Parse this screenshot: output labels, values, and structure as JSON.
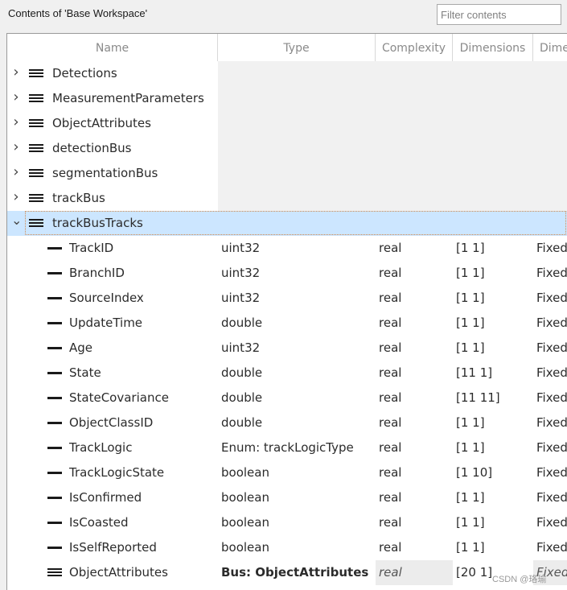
{
  "window": {
    "title": "Contents of 'Base Workspace'"
  },
  "filter": {
    "placeholder": "Filter contents"
  },
  "columns": [
    "Name",
    "Type",
    "Complexity",
    "Dimensions",
    "Dime"
  ],
  "rows": [
    {
      "name": "Detections",
      "type": "",
      "complexity": "",
      "dims": "",
      "dimMode": "",
      "kind": "bus",
      "level": 0,
      "expanded": false
    },
    {
      "name": "MeasurementParameters",
      "type": "",
      "complexity": "",
      "dims": "",
      "dimMode": "",
      "kind": "bus",
      "level": 0,
      "expanded": false
    },
    {
      "name": "ObjectAttributes",
      "type": "",
      "complexity": "",
      "dims": "",
      "dimMode": "",
      "kind": "bus",
      "level": 0,
      "expanded": false
    },
    {
      "name": "detectionBus",
      "type": "",
      "complexity": "",
      "dims": "",
      "dimMode": "",
      "kind": "bus",
      "level": 0,
      "expanded": false
    },
    {
      "name": "segmentationBus",
      "type": "",
      "complexity": "",
      "dims": "",
      "dimMode": "",
      "kind": "bus",
      "level": 0,
      "expanded": false
    },
    {
      "name": "trackBus",
      "type": "",
      "complexity": "",
      "dims": "",
      "dimMode": "",
      "kind": "bus",
      "level": 0,
      "expanded": false
    },
    {
      "name": "trackBusTracks",
      "type": "",
      "complexity": "",
      "dims": "",
      "dimMode": "",
      "kind": "bus",
      "level": 0,
      "expanded": true,
      "selected": true
    },
    {
      "name": "TrackID",
      "type": "uint32",
      "complexity": "real",
      "dims": "[1 1]",
      "dimMode": "Fixed",
      "kind": "element",
      "level": 1
    },
    {
      "name": "BranchID",
      "type": "uint32",
      "complexity": "real",
      "dims": "[1 1]",
      "dimMode": "Fixed",
      "kind": "element",
      "level": 1
    },
    {
      "name": "SourceIndex",
      "type": "uint32",
      "complexity": "real",
      "dims": "[1 1]",
      "dimMode": "Fixed",
      "kind": "element",
      "level": 1
    },
    {
      "name": "UpdateTime",
      "type": "double",
      "complexity": "real",
      "dims": "[1 1]",
      "dimMode": "Fixed",
      "kind": "element",
      "level": 1
    },
    {
      "name": "Age",
      "type": "uint32",
      "complexity": "real",
      "dims": "[1 1]",
      "dimMode": "Fixed",
      "kind": "element",
      "level": 1
    },
    {
      "name": "State",
      "type": "double",
      "complexity": "real",
      "dims": "[11 1]",
      "dimMode": "Fixed",
      "kind": "element",
      "level": 1
    },
    {
      "name": "StateCovariance",
      "type": "double",
      "complexity": "real",
      "dims": "[11 11]",
      "dimMode": "Fixed",
      "kind": "element",
      "level": 1
    },
    {
      "name": "ObjectClassID",
      "type": "double",
      "complexity": "real",
      "dims": "[1 1]",
      "dimMode": "Fixed",
      "kind": "element",
      "level": 1
    },
    {
      "name": "TrackLogic",
      "type": "Enum: trackLogicType",
      "complexity": "real",
      "dims": "[1 1]",
      "dimMode": "Fixed",
      "kind": "element",
      "level": 1
    },
    {
      "name": "TrackLogicState",
      "type": "boolean",
      "complexity": "real",
      "dims": "[1 10]",
      "dimMode": "Fixed",
      "kind": "element",
      "level": 1
    },
    {
      "name": "IsConfirmed",
      "type": "boolean",
      "complexity": "real",
      "dims": "[1 1]",
      "dimMode": "Fixed",
      "kind": "element",
      "level": 1
    },
    {
      "name": "IsCoasted",
      "type": "boolean",
      "complexity": "real",
      "dims": "[1 1]",
      "dimMode": "Fixed",
      "kind": "element",
      "level": 1
    },
    {
      "name": "IsSelfReported",
      "type": "boolean",
      "complexity": "real",
      "dims": "[1 1]",
      "dimMode": "Fixed",
      "kind": "element",
      "level": 1
    },
    {
      "name": "ObjectAttributes",
      "type": "Bus: ObjectAttributes",
      "complexity": "real",
      "dims": "[20 1]",
      "dimMode": "Fixed",
      "kind": "bus-element",
      "level": 1
    }
  ],
  "watermark": "CSDN @珞瑜"
}
